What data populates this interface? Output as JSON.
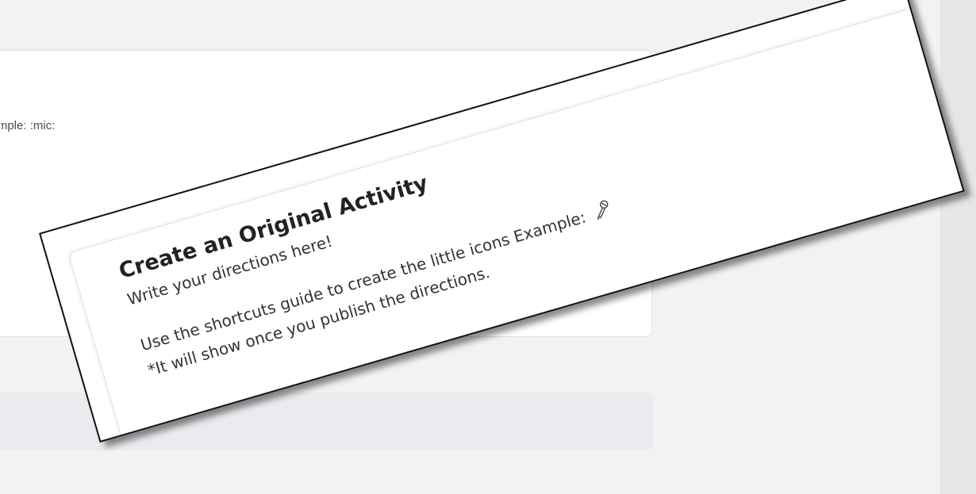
{
  "background_card": {
    "snippet": "Example:  :mic:"
  },
  "callout": {
    "title": "Create an Original Activity",
    "line1": "Write your directions here!",
    "line2": "Use the shortcuts guide to create the little icons Example:",
    "line2_icon": "microphone-icon",
    "line3": "*It will show once you publish the directions."
  }
}
